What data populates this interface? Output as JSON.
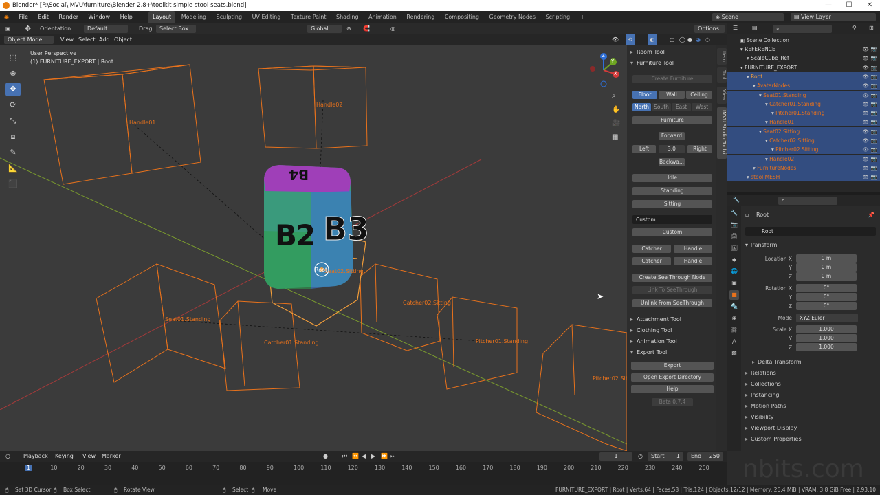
{
  "titlebar": {
    "title": "Blender* [F:\\Social\\IMVU\\furniture\\Blender 2.8+\\toolkit simple stool seats.blend]",
    "min": "—",
    "max": "☐",
    "close": "✕"
  },
  "menubar": {
    "items": [
      "File",
      "Edit",
      "Render",
      "Window",
      "Help"
    ],
    "workspaces": [
      "Layout",
      "Modeling",
      "Sculpting",
      "UV Editing",
      "Texture Paint",
      "Shading",
      "Animation",
      "Rendering",
      "Compositing",
      "Geometry Nodes",
      "Scripting"
    ],
    "add": "+",
    "scene": "Scene",
    "view_layer": "View Layer"
  },
  "toolhdr": {
    "orientation_label": "Orientation:",
    "orientation": "Default",
    "drag_label": "Drag:",
    "drag": "Select Box",
    "transform": "Global",
    "options": "Options"
  },
  "vphdr": {
    "mode": "Object Mode",
    "menus": [
      "View",
      "Select",
      "Add",
      "Object"
    ]
  },
  "viewport": {
    "perspective": "User Perspective",
    "context": "(1) FURNITURE_EXPORT | Root",
    "labels": [
      "Handle01",
      "Handle02",
      "Seat01.Standing",
      "Catcher01.Standing",
      "Catcher02.Sitting",
      "Pitcher01.Standing",
      "Pitcher02.Sitt",
      "Seat02.Sitting",
      "Root"
    ],
    "cube_text": [
      "B2",
      "B3",
      "B4"
    ]
  },
  "gizmo": {
    "x": "X",
    "y": "Y",
    "z": "Z"
  },
  "sidetabs": [
    "Item",
    "Tool",
    "View",
    "IMVU Studio Toolkit"
  ],
  "npanel": {
    "room_tool": "Room Tool",
    "furniture_tool": "Furniture Tool",
    "create_furniture": "Create Furniture",
    "floor": "Floor",
    "wall": "Wall",
    "ceiling": "Ceiling",
    "north": "North",
    "south": "South",
    "east": "East",
    "west": "West",
    "furniture": "Furniture",
    "forward": "Forward",
    "left": "Left",
    "step": "3.0",
    "right": "Right",
    "backward": "Backwa...",
    "idle": "Idle",
    "standing": "Standing",
    "sitting": "Sitting",
    "custom_field": "Custom",
    "custom_btn": "Custom",
    "catcher": "Catcher",
    "handle": "Handle",
    "create_see_through": "Create See Through Node",
    "link_see_through": "Link To SeeThrough",
    "unlink_see_through": "Unlink From SeeThrough",
    "attachment_tool": "Attachment Tool",
    "clothing_tool": "Clothing Tool",
    "animation_tool": "Animation Tool",
    "export_tool": "Export Tool",
    "export": "Export",
    "open_export_dir": "Open Export Directory",
    "help": "Help",
    "beta": "Beta 0.7.4"
  },
  "outliner": {
    "header": "Scene Collection",
    "rows": [
      {
        "label": "REFERENCE",
        "indent": 1
      },
      {
        "label": "ScaleCube_Ref",
        "indent": 2
      },
      {
        "label": "FURNITURE_EXPORT",
        "indent": 1
      },
      {
        "label": "Root",
        "indent": 2
      },
      {
        "label": "AvatarNodes",
        "indent": 3
      },
      {
        "label": "Seat01.Standing",
        "indent": 4
      },
      {
        "label": "Catcher01.Standing",
        "indent": 5
      },
      {
        "label": "Pitcher01.Standing",
        "indent": 6
      },
      {
        "label": "Handle01",
        "indent": 5
      },
      {
        "label": "Seat02.Sitting",
        "indent": 4
      },
      {
        "label": "Catcher02.Sitting",
        "indent": 5
      },
      {
        "label": "Pitcher02.Sitting",
        "indent": 6
      },
      {
        "label": "Handle02",
        "indent": 5
      },
      {
        "label": "FurnitureNodes",
        "indent": 3
      },
      {
        "label": "stool.MESH",
        "indent": 2
      }
    ]
  },
  "props": {
    "object": "Root",
    "name": "Root",
    "transform": "Transform",
    "location_x": "Location X",
    "y": "Y",
    "z": "Z",
    "loc": [
      "0 m",
      "0 m",
      "0 m"
    ],
    "rotation_x": "Rotation X",
    "rot": [
      "0°",
      "0°",
      "0°"
    ],
    "mode_label": "Mode",
    "mode": "XYZ Euler",
    "scale_x": "Scale X",
    "scale": [
      "1.000",
      "1.000",
      "1.000"
    ],
    "delta": "Delta Transform",
    "sections": [
      "Relations",
      "Collections",
      "Instancing",
      "Motion Paths",
      "Visibility",
      "Viewport Display",
      "Custom Properties"
    ]
  },
  "timeline": {
    "menus": [
      "Playback",
      "Keying",
      "View",
      "Marker"
    ],
    "frame": "1",
    "start_label": "Start",
    "start": "1",
    "end_label": "End",
    "end": "250",
    "ticks": [
      "1",
      "10",
      "20",
      "30",
      "40",
      "50",
      "60",
      "70",
      "80",
      "90",
      "100",
      "110",
      "120",
      "130",
      "140",
      "150",
      "160",
      "170",
      "180",
      "190",
      "200",
      "210",
      "220",
      "230",
      "240",
      "250"
    ]
  },
  "statusbar": {
    "set_cursor": "Set 3D Cursor",
    "box_select": "Box Select",
    "rotate_view": "Rotate View",
    "select": "Select",
    "move": "Move",
    "stats": "FURNITURE_EXPORT | Root | Verts:64 | Faces:58 | Tris:124 | Objects:12/12 | Memory: 26.4 MiB | VRAM: 3.8 GiB Free | 2.93.10"
  },
  "watermark": "nbits.com",
  "colors": {
    "accent": "#4772b3",
    "orange": "#e8721c",
    "active_ws": "#3f3f3f",
    "bg": "#1d1d1d"
  }
}
